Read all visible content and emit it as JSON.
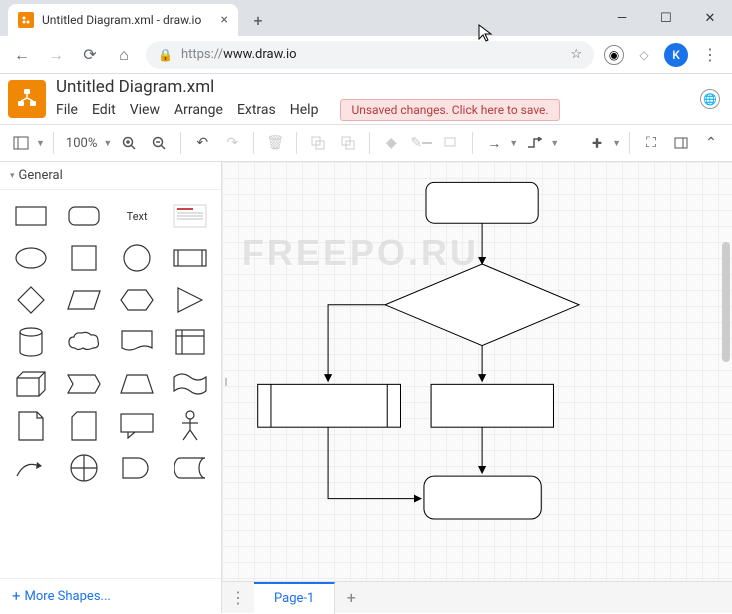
{
  "browser": {
    "tab_title": "Untitled Diagram.xml - draw.io",
    "url_proto": "https://",
    "url_host": "www.draw.io",
    "avatar_letter": "K"
  },
  "app": {
    "title": "Untitled Diagram.xml",
    "menu": [
      "File",
      "Edit",
      "View",
      "Arrange",
      "Extras",
      "Help"
    ],
    "unsaved": "Unsaved changes. Click here to save."
  },
  "toolbar": {
    "zoom": "100%"
  },
  "sidebar": {
    "category": "General",
    "text_label": "Text",
    "more_shapes": "More Shapes..."
  },
  "watermark": "FREEPO.RU",
  "page": {
    "current": "Page-1"
  }
}
